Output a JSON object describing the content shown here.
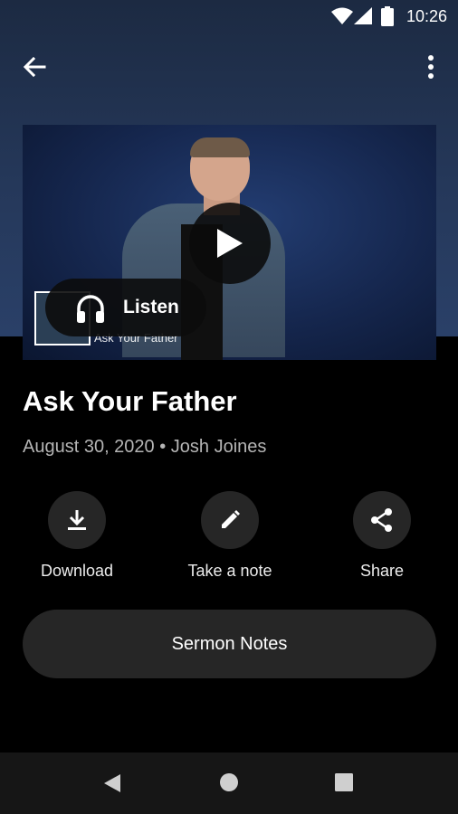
{
  "status_bar": {
    "time": "10:26"
  },
  "media": {
    "listen_label": "Listen",
    "thumbnail_caption": "Ask Your Father"
  },
  "sermon": {
    "title": "Ask Your Father",
    "meta": "August 30, 2020 • Josh Joines"
  },
  "actions": [
    {
      "label": "Download",
      "icon": "download-icon"
    },
    {
      "label": "Take a note",
      "icon": "pencil-icon"
    },
    {
      "label": "Share",
      "icon": "share-icon"
    }
  ],
  "sermon_notes_label": "Sermon Notes",
  "colors": {
    "background": "#000000",
    "hero_blue": "#25385a",
    "button_fill": "#262626",
    "meta_gray": "#b5b5b5"
  }
}
